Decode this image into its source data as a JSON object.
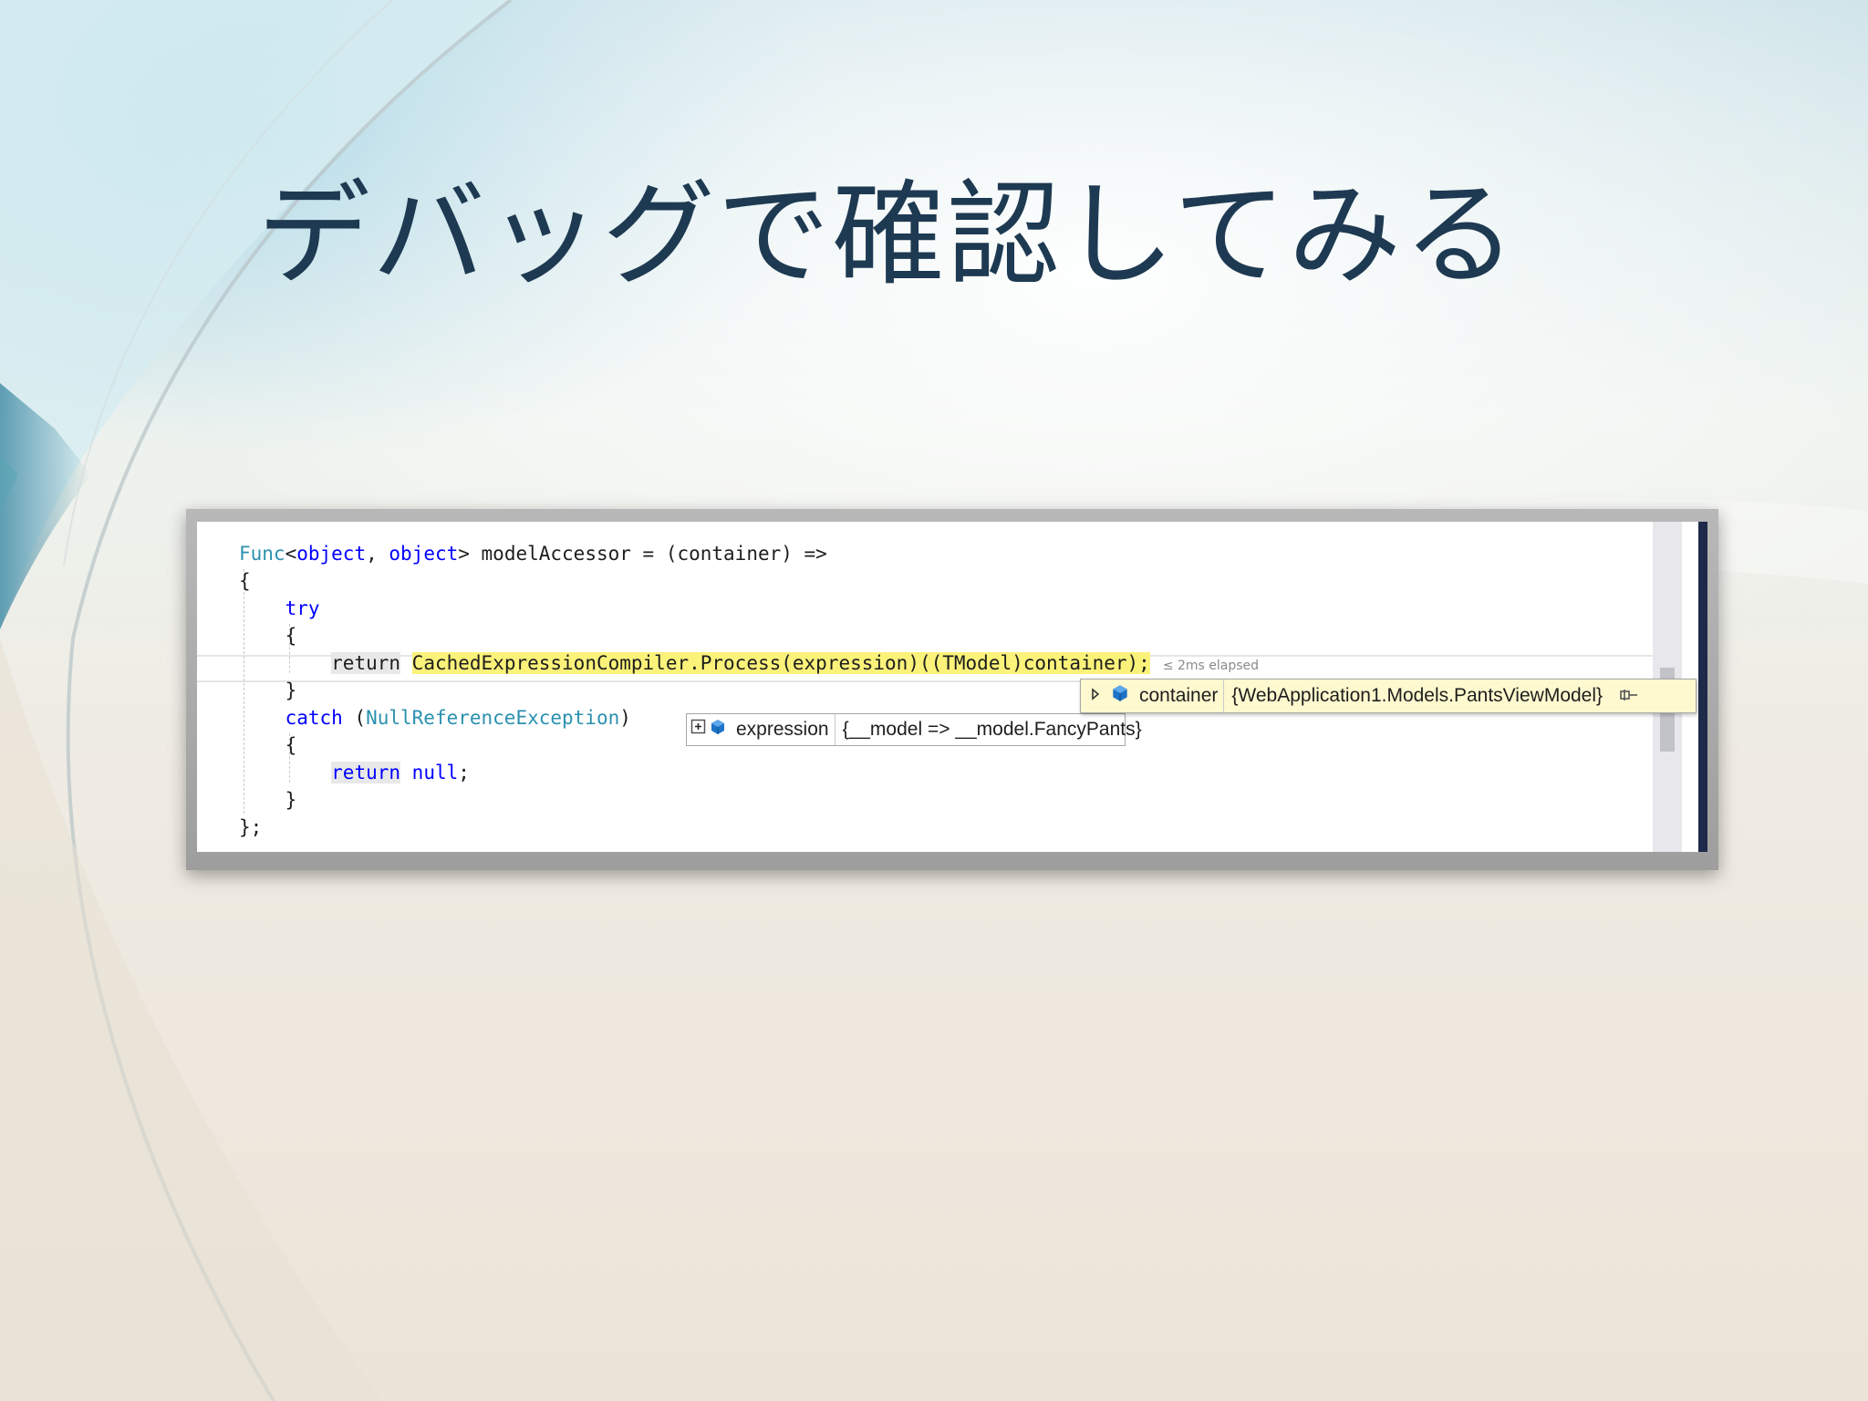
{
  "slide": {
    "title": "デバッグで確認してみる"
  },
  "code": {
    "line1": {
      "t1": "Func",
      "t2": "<",
      "t3": "object",
      "t4": ", ",
      "t5": "object",
      "t6": "> modelAccessor = (container) =>"
    },
    "line2": "{",
    "line3": "try",
    "line4": "{",
    "line5": {
      "kw": "return",
      "space": " ",
      "expr": "CachedExpressionCompiler.Process(expression)((TModel)container);",
      "elapsed": "≤ 2ms elapsed"
    },
    "line6": "}",
    "line7": {
      "kw": "catch",
      "open": " (",
      "type": "NullReferenceException",
      "close": ")"
    },
    "line8": "{",
    "line9": {
      "kw": "return",
      "rest_kw": "null",
      "semi": ";"
    },
    "line10": "}",
    "line11": "};"
  },
  "datatips": {
    "container": {
      "name": "container",
      "value": "{WebApplication1.Models.PantsViewModel}"
    },
    "expression": {
      "name": "expression",
      "value": "{__model => __model.FancyPants}"
    }
  },
  "icons": [
    "expand-arrow-icon",
    "object-cube-icon",
    "pin-icon",
    "expand-box-icon"
  ]
}
